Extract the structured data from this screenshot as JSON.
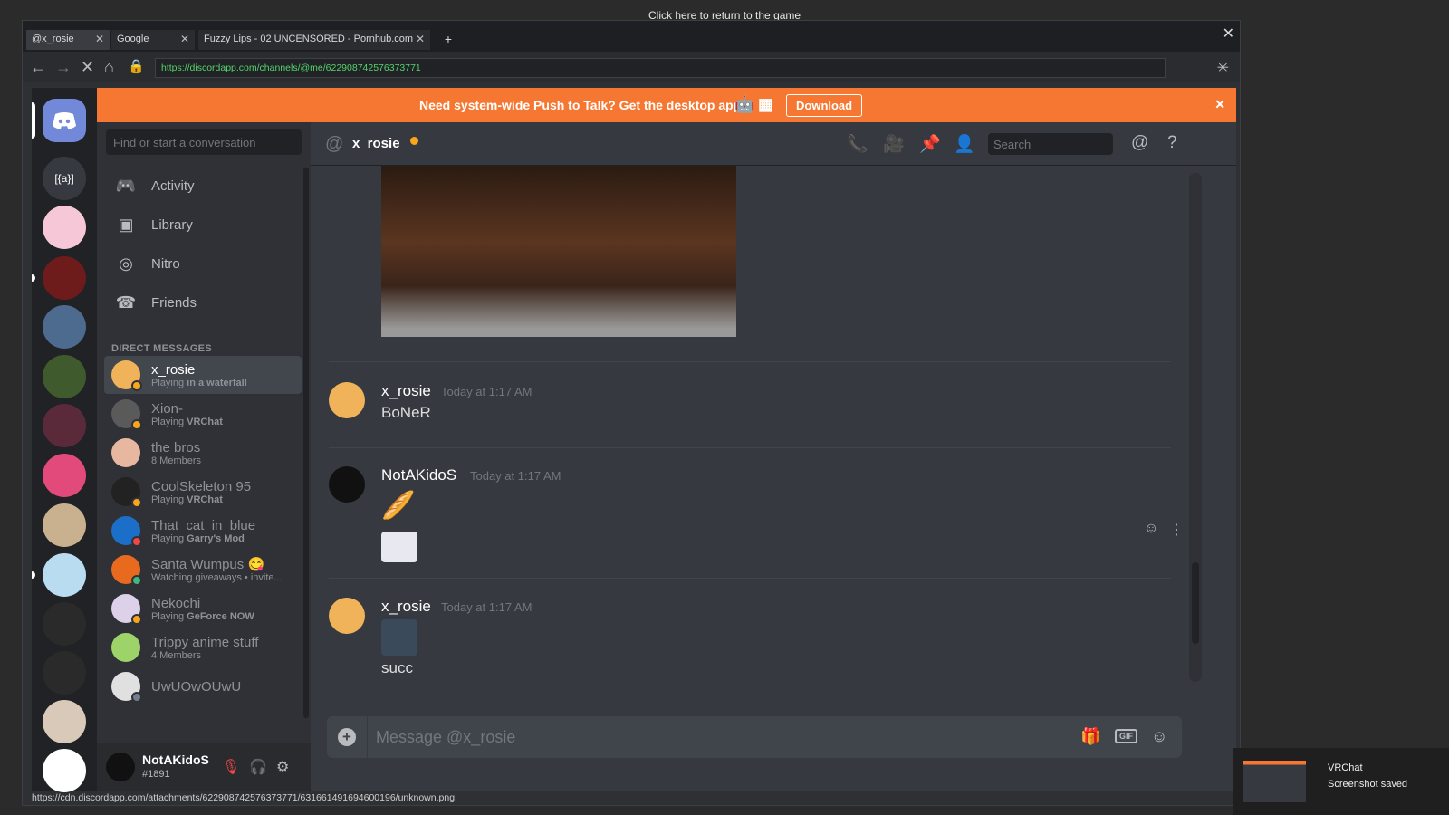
{
  "overlay": {
    "return_text": "Click here to return to the game"
  },
  "browser": {
    "tabs": [
      {
        "label": "@x_rosie"
      },
      {
        "label": "Google"
      },
      {
        "label": "Fuzzy Lips - 02 UNCENSORED - Pornhub.com"
      }
    ],
    "new_tab": "+",
    "url": "https://discordapp.com/channels/@me/622908742576373771",
    "status_url": "https://cdn.discordapp.com/attachments/622908742576373771/631661491694600196/unknown.png"
  },
  "banner": {
    "text": "Need system-wide Push to Talk? Get the desktop app!",
    "download_label": "Download"
  },
  "sidebar": {
    "search_placeholder": "Find or start a conversation",
    "nav": [
      {
        "label": "Activity",
        "icon": "controller-icon"
      },
      {
        "label": "Library",
        "icon": "library-icon"
      },
      {
        "label": "Nitro",
        "icon": "nitro-icon"
      },
      {
        "label": "Friends",
        "icon": "friends-icon"
      }
    ],
    "dm_header": "DIRECT MESSAGES",
    "dms": [
      {
        "name": "x_rosie",
        "sub_prefix": "Playing ",
        "sub_bold": "in a waterfall",
        "color": "#f0b35a",
        "status": "#faa61a"
      },
      {
        "name": "Xion-",
        "sub_prefix": "Playing ",
        "sub_bold": "VRChat",
        "color": "#5a5a5a",
        "status": "#faa61a"
      },
      {
        "name": "the bros",
        "sub_prefix": "8 Members",
        "sub_bold": "",
        "color": "#e8b7a0",
        "status": ""
      },
      {
        "name": "CoolSkeleton 95",
        "sub_prefix": "Playing ",
        "sub_bold": "VRChat",
        "color": "#222",
        "status": "#faa61a"
      },
      {
        "name": "That_cat_in_blue",
        "sub_prefix": "Playing ",
        "sub_bold": "Garry's Mod",
        "color": "#1b6fc9",
        "status": "#f04747"
      },
      {
        "name": "Santa Wumpus 😋",
        "sub_prefix": "Watching giveaways • invite...",
        "sub_bold": "",
        "color": "#e86a1f",
        "status": "#43b581"
      },
      {
        "name": "Nekochi",
        "sub_prefix": "Playing ",
        "sub_bold": "GeForce NOW",
        "color": "#dcd1e8",
        "status": "#faa61a"
      },
      {
        "name": "Trippy anime stuff",
        "sub_prefix": "4 Members",
        "sub_bold": "",
        "color": "#9ed36a",
        "status": ""
      },
      {
        "name": "UwUOwOUwU",
        "sub_prefix": "",
        "sub_bold": "",
        "color": "#e0e0e0",
        "status": "#747f8d"
      }
    ]
  },
  "user": {
    "name": "NotAKidoS",
    "tag": "#1891"
  },
  "chat": {
    "channel_name": "x_rosie",
    "search_placeholder": "Search",
    "messages": [
      {
        "author": "x_rosie",
        "timestamp": "Today at 1:17 AM",
        "content": "BoNeR"
      },
      {
        "author": "NotAKidoS",
        "timestamp": "Today at 1:17 AM",
        "content": "🥖"
      },
      {
        "author": "x_rosie",
        "timestamp": "Today at 1:17 AM",
        "content": "succ"
      }
    ],
    "composer_placeholder": "Message @x_rosie",
    "gif_label": "GIF"
  },
  "toast": {
    "app": "VRChat",
    "message": "Screenshot saved"
  }
}
